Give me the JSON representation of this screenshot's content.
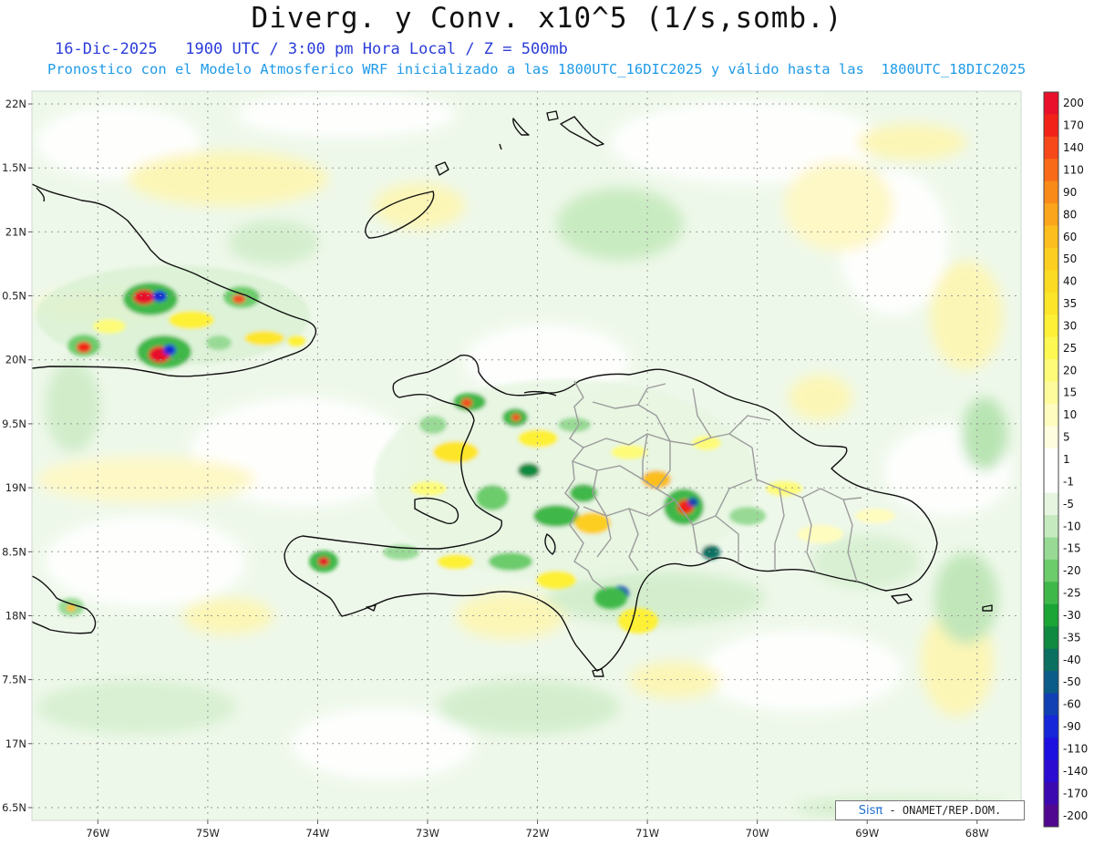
{
  "header": {
    "title": "Diverg. y Conv. x10^5 (1/s,somb.)",
    "line1": "16-Dic-2025   1900 UTC / 3:00 pm Hora Local / Z = 500mb",
    "line2": "Pronostico con el Modelo Atmosferico WRF inicializado a las 1800UTC_16DIC2025 y válido hasta las  1800UTC_18DIC2025"
  },
  "map": {
    "lon_range": [
      -76.6,
      -67.6
    ],
    "lat_range": [
      16.4,
      22.1
    ],
    "lat_labels": [
      "22N",
      "1.5N",
      "21N",
      "0.5N",
      "20N",
      "9.5N",
      "19N",
      "8.5N",
      "18N",
      "7.5N",
      "17N",
      "6.5N"
    ],
    "lat_values": [
      22,
      21.5,
      21,
      20.5,
      20,
      19.5,
      19,
      18.5,
      18,
      17.5,
      17,
      16.5
    ],
    "lon_labels": [
      "76W",
      "75W",
      "74W",
      "73W",
      "72W",
      "71W",
      "70W",
      "69W",
      "68W"
    ],
    "lon_values": [
      -76,
      -75,
      -74,
      -73,
      -72,
      -71,
      -70,
      -69,
      -68
    ]
  },
  "colorbar": {
    "labels": [
      "200",
      "170",
      "140",
      "110",
      "90",
      "80",
      "60",
      "50",
      "40",
      "35",
      "30",
      "25",
      "20",
      "15",
      "10",
      "5",
      "1",
      "-1",
      "-5",
      "-10",
      "-15",
      "-20",
      "-25",
      "-30",
      "-35",
      "-40",
      "-50",
      "-60",
      "-90",
      "-110",
      "-140",
      "-170",
      "-200"
    ],
    "colors": [
      "#e8102a",
      "#f22218",
      "#f7481a",
      "#f96a18",
      "#f98a18",
      "#faa51b",
      "#fbbe1e",
      "#fcce20",
      "#fcdb24",
      "#fde52a",
      "#fdf036",
      "#fdf852",
      "#fdfb78",
      "#fefb9c",
      "#fefcbe",
      "#fffde0",
      "#ffffff",
      "#ffffff",
      "#e6f5e0",
      "#c6eac0",
      "#98da95",
      "#6ccc6c",
      "#3fb84a",
      "#1aa536",
      "#108a40",
      "#0c7060",
      "#0b5c88",
      "#1040b4",
      "#1626d8",
      "#1c10e0",
      "#2c0cd0",
      "#3c08b0",
      "#500890"
    ]
  },
  "credit": {
    "brand": "Sisπ",
    "text": " - ONAMET/REP.DOM."
  }
}
